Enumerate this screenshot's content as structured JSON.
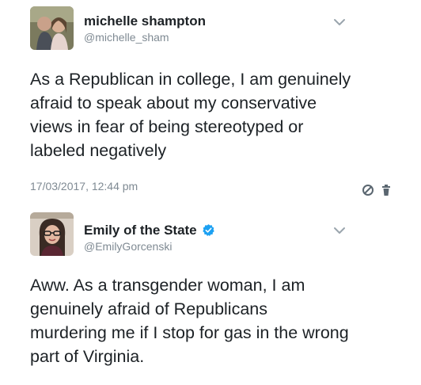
{
  "tweets": [
    {
      "author_name": "michelle shampton",
      "handle": "@michelle_sham",
      "verified": false,
      "lines": [
        "As a Republican in college, I am genuinely",
        "afraid to speak about my conservative",
        "views in fear of being stereotyped or",
        "labeled negatively"
      ],
      "timestamp": "17/03/2017, 12:44 pm",
      "icons": [
        "chevron-down-icon",
        "block-icon",
        "trash-icon"
      ]
    },
    {
      "author_name": "Emily of the State",
      "handle": "@EmilyGorcenski",
      "verified": true,
      "lines": [
        "Aww. As a transgender woman, I am",
        "genuinely afraid of Republicans",
        "murdering me if I stop for gas in the wrong",
        "part of Virginia."
      ],
      "icons": [
        "chevron-down-icon",
        "verified-badge-icon"
      ]
    }
  ],
  "colors": {
    "text": "#1c2125",
    "secondary": "#7f8a93",
    "verified": "#1da1f2",
    "chevron": "#9aa5ad"
  }
}
